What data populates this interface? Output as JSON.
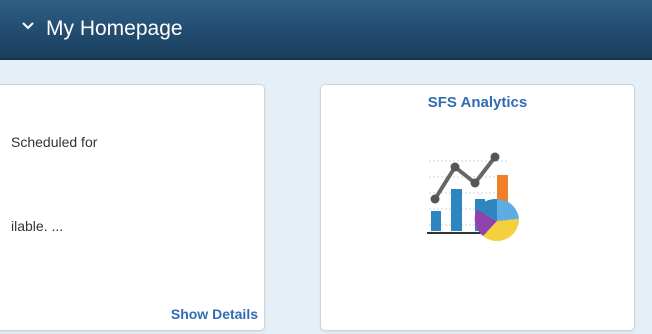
{
  "header": {
    "title": "My Homepage",
    "chevron_icon": "chevron-down-icon"
  },
  "tiles": [
    {
      "line1": "Scheduled for",
      "line2": "ilable. ...",
      "action_label": "Show Details"
    },
    {
      "title": "SFS Analytics",
      "icon": "analytics-chart-icon"
    }
  ],
  "colors": {
    "header": "#224c6f",
    "link": "#2f6db4",
    "background": "#e6eef6"
  }
}
